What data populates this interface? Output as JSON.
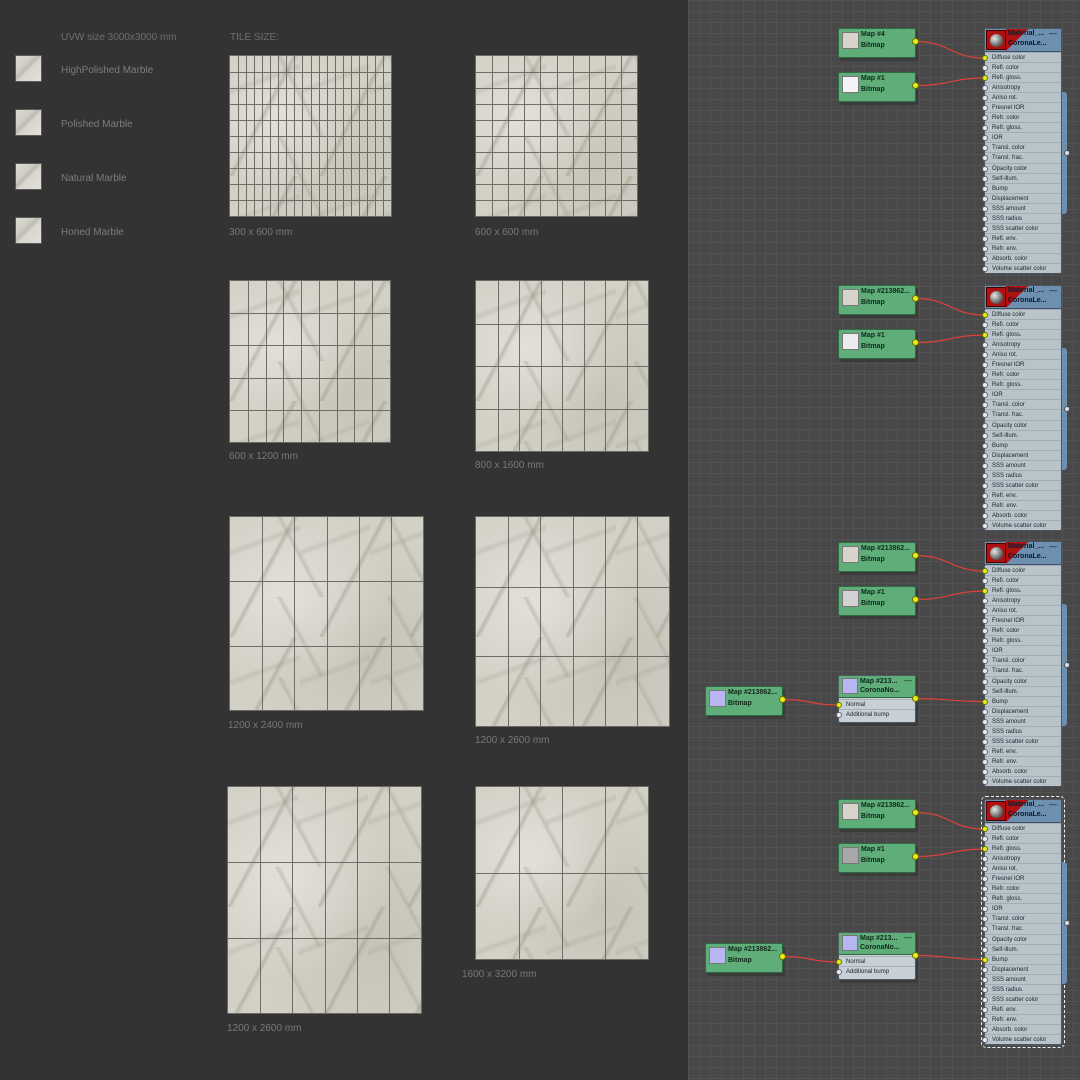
{
  "left_panel": {
    "uvw_header": "UVW size 3000x3000 mm",
    "tile_size_header": "TILE SIZE:",
    "materials": [
      {
        "label": "HighPolished Marble"
      },
      {
        "label": "Polished Marble"
      },
      {
        "label": "Natural Marble"
      },
      {
        "label": "Honed Marble"
      }
    ],
    "tiles": [
      {
        "label": "300 x 600 mm",
        "cols": 20,
        "rows": 10
      },
      {
        "label": "600 x 600 mm",
        "cols": 10,
        "rows": 10
      },
      {
        "label": "600 x 1200 mm",
        "cols": 9,
        "rows": 5
      },
      {
        "label": "800 x 1600 mm",
        "cols": 8,
        "rows": 4
      },
      {
        "label": "1200 x 2400 mm",
        "cols": 6,
        "rows": 3
      },
      {
        "label": "1200 x 2600 mm",
        "cols": 6,
        "rows": 3
      },
      {
        "label": "1200 x 2600 mm",
        "cols": 6,
        "rows": 3
      },
      {
        "label": "1600 x 3200 mm",
        "cols": 4,
        "rows": 2
      }
    ]
  },
  "node_editor": {
    "colors": {
      "map_node": "#5fae7a",
      "material_header": "#6d8fb0",
      "wire": "#e0403a",
      "active_socket": "#e5ef1a"
    },
    "material_slots": [
      "Diffuse color",
      "Refl. color",
      "Refl. gloss.",
      "Anisotropy",
      "Aniso rot.",
      "Fresnel IOR",
      "Refr. color",
      "Refr. gloss.",
      "IOR",
      "Transl. color",
      "Transl. frac.",
      "Opacity color",
      "Self-illum.",
      "Bump",
      "Displacement",
      "SSS amount",
      "SSS radius",
      "SSS scatter color",
      "Refl. env.",
      "Refr. env.",
      "Absorb. color",
      "Volume scatter color"
    ],
    "groups": [
      {
        "material": {
          "line1": "Material_...",
          "line2": "CoronaLe...",
          "minus": "—"
        },
        "diffuse_map": {
          "name": "Map #4",
          "type": "Bitmap",
          "thumb_color": "#d6d4cb"
        },
        "gloss_map": {
          "name": "Map #1",
          "type": "Bitmap",
          "thumb_color": "#f4f4f4"
        },
        "bump": null
      },
      {
        "material": {
          "line1": "Material_...",
          "line2": "CoronaLe...",
          "minus": "—"
        },
        "diffuse_map": {
          "name": "Map #213862...",
          "type": "Bitmap",
          "thumb_color": "#d6d4cb"
        },
        "gloss_map": {
          "name": "Map #1",
          "type": "Bitmap",
          "thumb_color": "#ececec"
        },
        "bump": null
      },
      {
        "material": {
          "line1": "Material_...",
          "line2": "CoronaLe...",
          "minus": "—"
        },
        "diffuse_map": {
          "name": "Map #213862...",
          "type": "Bitmap",
          "thumb_color": "#d6d4cb"
        },
        "gloss_map": {
          "name": "Map #1",
          "type": "Bitmap",
          "thumb_color": "#d2d2d2"
        },
        "bump": {
          "normal_node": {
            "line1": "Map #213...",
            "line2": "CoronaNo...",
            "minus": "—",
            "slot_normal": "Normal",
            "slot_additional": "Additional bump"
          },
          "normal_map": {
            "name": "Map #213862...",
            "type": "Bitmap",
            "thumb_color": "#b8b6f0"
          }
        }
      },
      {
        "material": {
          "line1": "Material_...",
          "line2": "CoronaLe...",
          "minus": "—"
        },
        "diffuse_map": {
          "name": "Map #213862...",
          "type": "Bitmap",
          "thumb_color": "#d6d4cb"
        },
        "gloss_map": {
          "name": "Map #1",
          "type": "Bitmap",
          "thumb_color": "#a8a8a8"
        },
        "bump": {
          "normal_node": {
            "line1": "Map #213...",
            "line2": "CoronaNo...",
            "minus": "—",
            "slot_normal": "Normal",
            "slot_additional": "Additional bump"
          },
          "normal_map": {
            "name": "Map #213862...",
            "type": "Bitmap",
            "thumb_color": "#b8b6f0"
          }
        }
      }
    ]
  }
}
